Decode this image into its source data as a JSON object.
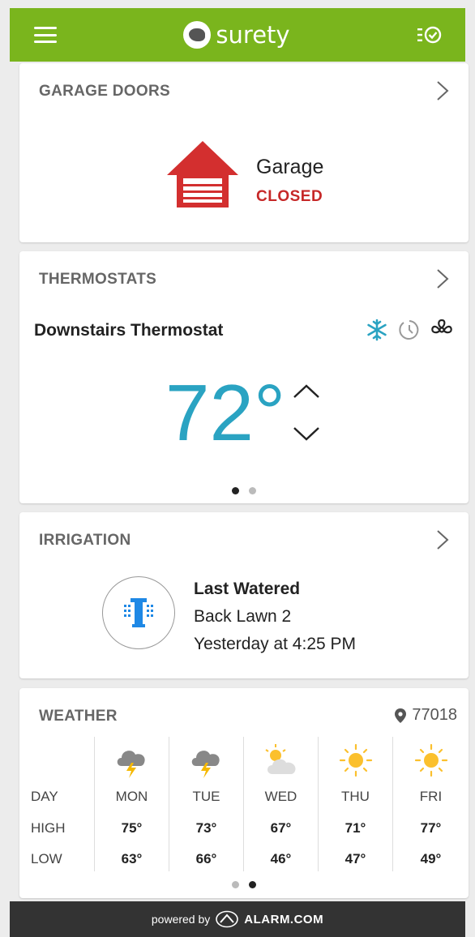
{
  "app": {
    "brand": "surety"
  },
  "colors": {
    "brand_green": "#7ab51d",
    "temp_blue": "#2aa3c2",
    "closed_red": "#c62828",
    "garage_red": "#d32f2f"
  },
  "garage": {
    "section_title": "GARAGE DOORS",
    "name": "Garage",
    "status": "CLOSED"
  },
  "thermostat": {
    "section_title": "THERMOSTATS",
    "name": "Downstairs Thermostat",
    "temperature": "72°",
    "mode_icons": [
      "snowflake-icon",
      "schedule-icon",
      "fan-icon"
    ],
    "page_count": 2,
    "active_page": 1
  },
  "irrigation": {
    "section_title": "IRRIGATION",
    "label": "Last Watered",
    "zone": "Back Lawn 2",
    "when": "Yesterday at 4:25 PM"
  },
  "weather": {
    "section_title": "WEATHER",
    "zip": "77018",
    "row_labels": {
      "day": "DAY",
      "high": "HIGH",
      "low": "LOW"
    },
    "days": [
      {
        "day": "MON",
        "high": "75°",
        "low": "63°",
        "icon": "thunderstorm-icon"
      },
      {
        "day": "TUE",
        "high": "73°",
        "low": "66°",
        "icon": "thunderstorm-icon"
      },
      {
        "day": "WED",
        "high": "67°",
        "low": "46°",
        "icon": "partly-cloudy-icon"
      },
      {
        "day": "THU",
        "high": "71°",
        "low": "47°",
        "icon": "sun-icon"
      },
      {
        "day": "FRI",
        "high": "77°",
        "low": "49°",
        "icon": "sun-icon"
      }
    ],
    "page_count": 2,
    "active_page": 2
  },
  "footer": {
    "prefix": "powered by",
    "brand": "ALARM.COM"
  }
}
